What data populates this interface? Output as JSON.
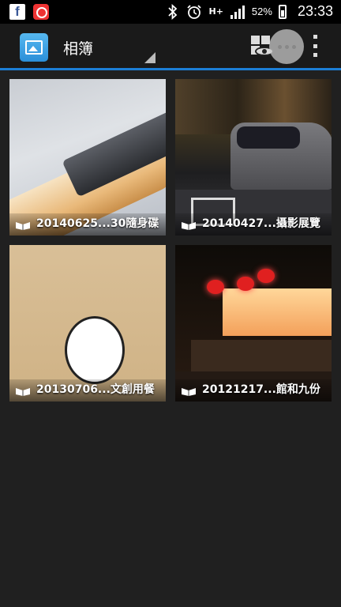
{
  "status_bar": {
    "notification_icons": [
      "facebook-icon",
      "app-notification-icon"
    ],
    "system_icons": [
      "bluetooth-icon",
      "alarm-icon",
      "network-hplus-icon",
      "signal-icon"
    ],
    "network_type": "H+",
    "battery_percent": "52%",
    "time": "23:33"
  },
  "action_bar": {
    "title": "相簿",
    "app_icon": "gallery-icon",
    "actions": [
      "view-mode-icon",
      "loading-indicator-icon",
      "overflow-menu-icon"
    ]
  },
  "albums": [
    {
      "caption": "20140625...30隨身碟"
    },
    {
      "caption": "20140427...攝影展覽"
    },
    {
      "caption": "20130706...文創用餐"
    },
    {
      "caption": "20121217...館和九份"
    }
  ],
  "colors": {
    "accent": "#1c7fd6",
    "background": "#202020",
    "status_bar": "#000000",
    "action_bar": "#1a1a1a"
  }
}
